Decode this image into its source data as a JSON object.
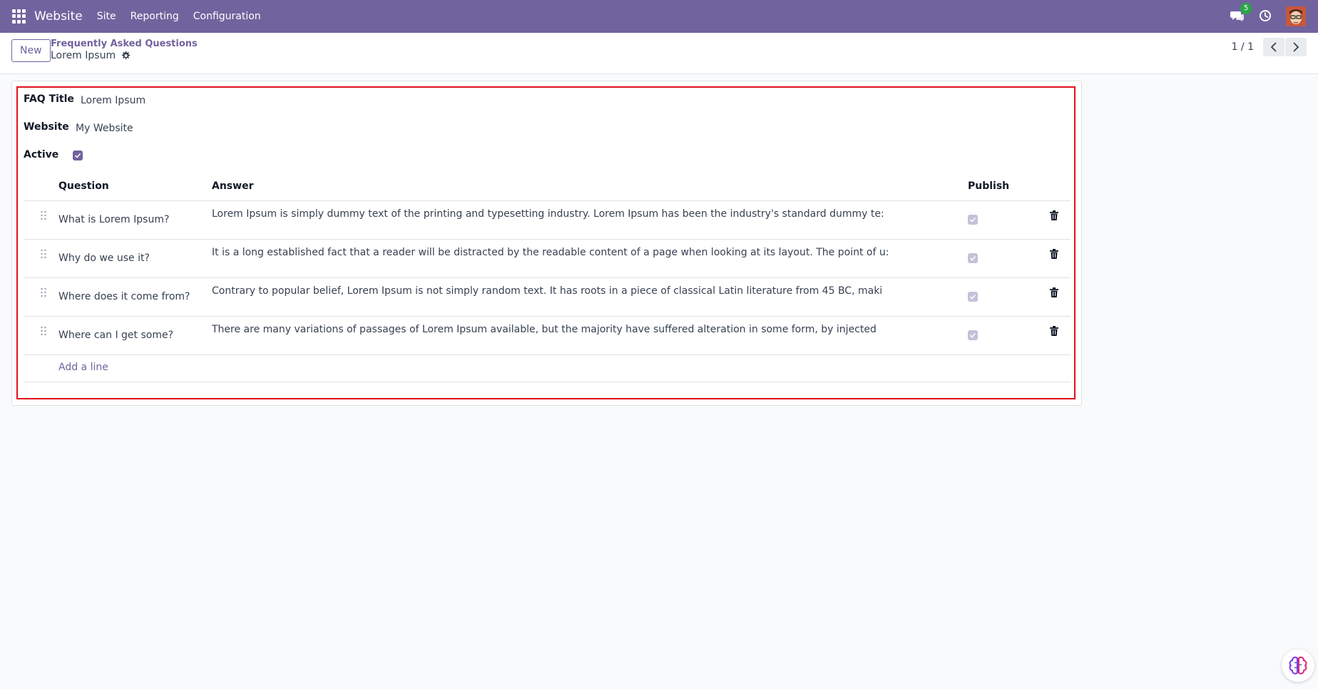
{
  "navbar": {
    "brand": "Website",
    "menus": [
      "Site",
      "Reporting",
      "Configuration"
    ],
    "chat_count": "5",
    "icons": [
      "apps-grid-icon",
      "chat-icon",
      "clock-icon",
      "avatar"
    ]
  },
  "control_panel": {
    "new_label": "New",
    "breadcrumb_parent": "Frequently Asked Questions",
    "breadcrumb_current": "Lorem Ipsum",
    "pager": "1 / 1"
  },
  "form": {
    "faq_title_label": "FAQ Title",
    "faq_title_value": "Lorem Ipsum",
    "website_label": "Website",
    "website_value": "My Website",
    "active_label": "Active",
    "active_checked": true
  },
  "table": {
    "headers": {
      "question": "Question",
      "answer": "Answer",
      "publish": "Publish"
    },
    "rows": [
      {
        "question": "What is Lorem Ipsum?",
        "answer": "Lorem Ipsum is simply dummy text of the printing and typesetting industry. Lorem Ipsum has been the industry's standard dummy te:",
        "publish": true
      },
      {
        "question": "Why do we use it?",
        "answer": "It is a long established fact that a reader will be distracted by the readable content of a page when looking at its layout. The point of u:",
        "publish": true
      },
      {
        "question": "Where does it come from?",
        "answer": "Contrary to popular belief, Lorem Ipsum is not simply random text. It has roots in a piece of classical Latin literature from 45 BC, maki",
        "publish": true
      },
      {
        "question": "Where can I get some?",
        "answer": "There are many variations of passages of Lorem Ipsum available, but the majority have suffered alteration in some form, by injected",
        "publish": true
      }
    ],
    "add_line_label": "Add a line"
  },
  "colors": {
    "brand": "#71639e",
    "highlight": "#e0101b",
    "badge": "#28a745"
  }
}
